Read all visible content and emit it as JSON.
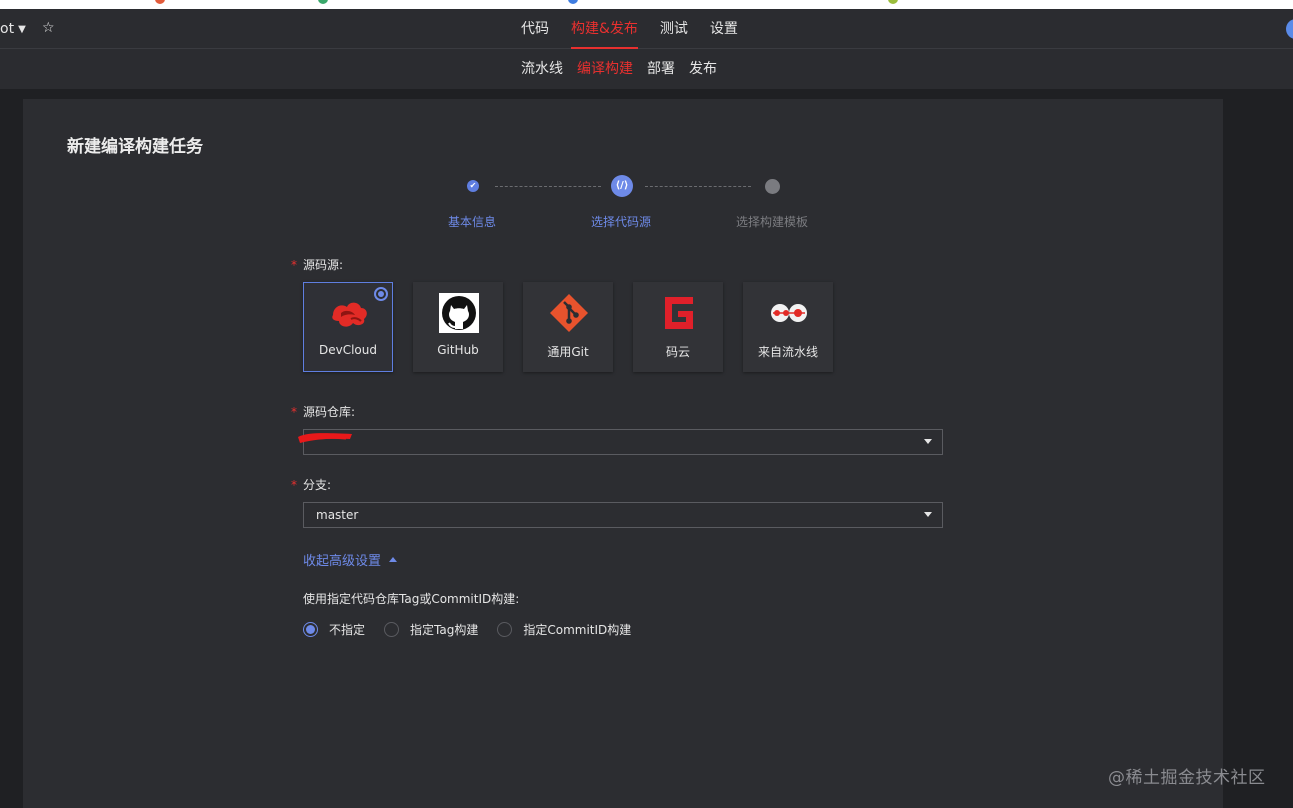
{
  "topnav": {
    "project_name": "ot",
    "tabs": [
      {
        "label": "代码"
      },
      {
        "label": "构建&发布"
      },
      {
        "label": "测试"
      },
      {
        "label": "设置"
      }
    ],
    "active_tab_index": 1
  },
  "subnav": {
    "tabs": [
      {
        "label": "流水线"
      },
      {
        "label": "编译构建"
      },
      {
        "label": "部署"
      },
      {
        "label": "发布"
      }
    ],
    "active_tab_index": 1
  },
  "page": {
    "title": "新建编译构建任务"
  },
  "steps": [
    {
      "label": "基本信息",
      "status": "done"
    },
    {
      "label": "选择代码源",
      "status": "current"
    },
    {
      "label": "选择构建模板",
      "status": "pending"
    }
  ],
  "form": {
    "required_mark": "*",
    "source_label": "源码源:",
    "sources": [
      {
        "name": "DevCloud",
        "icon": "devcloud-logo-icon",
        "selected": true
      },
      {
        "name": "GitHub",
        "icon": "github-logo-icon",
        "selected": false
      },
      {
        "name": "通用Git",
        "icon": "git-logo-icon",
        "selected": false
      },
      {
        "name": "码云",
        "icon": "gitee-logo-icon",
        "selected": false
      },
      {
        "name": "来自流水线",
        "icon": "pipeline-logo-icon",
        "selected": false
      }
    ],
    "repo_label": "源码仓库:",
    "repo_value": "",
    "branch_label": "分支:",
    "branch_value": "master",
    "advanced_toggle": "收起高级设置",
    "advanced_label": "使用指定代码仓库Tag或CommitID构建:",
    "build_ref_options": [
      {
        "label": "不指定",
        "checked": true
      },
      {
        "label": "指定Tag构建",
        "checked": false
      },
      {
        "label": "指定CommitID构建",
        "checked": false
      }
    ]
  },
  "watermark": "@稀土掘金技术社区",
  "colors": {
    "accent_red": "#e8302f",
    "accent_blue": "#6e8ae8",
    "panel_bg": "#2c2d31",
    "page_bg": "#1f2023"
  }
}
